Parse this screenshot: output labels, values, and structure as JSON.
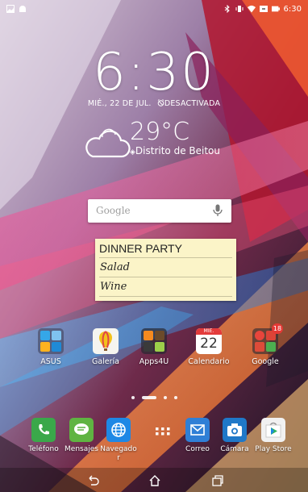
{
  "status_bar": {
    "time": "6:30",
    "left_icons": [
      "gallery-icon",
      "android-icon"
    ],
    "right_icons": [
      "bluetooth-icon",
      "vibrate-icon",
      "wifi-icon",
      "battery-saver-icon",
      "battery-icon"
    ]
  },
  "lock": {
    "clock": "6:30",
    "date": "MIÉ., 22 DE JUL.",
    "alarm": "DESACTIVADA"
  },
  "weather": {
    "temperature": "29°C",
    "location": "Distrito de Beitou"
  },
  "search": {
    "placeholder": "Google"
  },
  "memo": {
    "title": "DINNER PARTY",
    "items": [
      "Salad",
      "Wine"
    ]
  },
  "apps": [
    {
      "label": "ASUS"
    },
    {
      "label": "Galería"
    },
    {
      "label": "Apps4U"
    },
    {
      "label": "Calendario",
      "day_abbr": "MIÉ.",
      "day": "22"
    },
    {
      "label": "Google",
      "badge": "18"
    }
  ],
  "dock": [
    {
      "label": "Teléfono"
    },
    {
      "label": "Mensajes"
    },
    {
      "label": "Navegado r"
    },
    {
      "label": "Apps"
    },
    {
      "label": "Correo"
    },
    {
      "label": "Cámara"
    },
    {
      "label": "Play Store"
    }
  ],
  "pages": {
    "count": 4,
    "current": 2
  },
  "nav": [
    "back-icon",
    "home-icon",
    "recents-icon"
  ]
}
